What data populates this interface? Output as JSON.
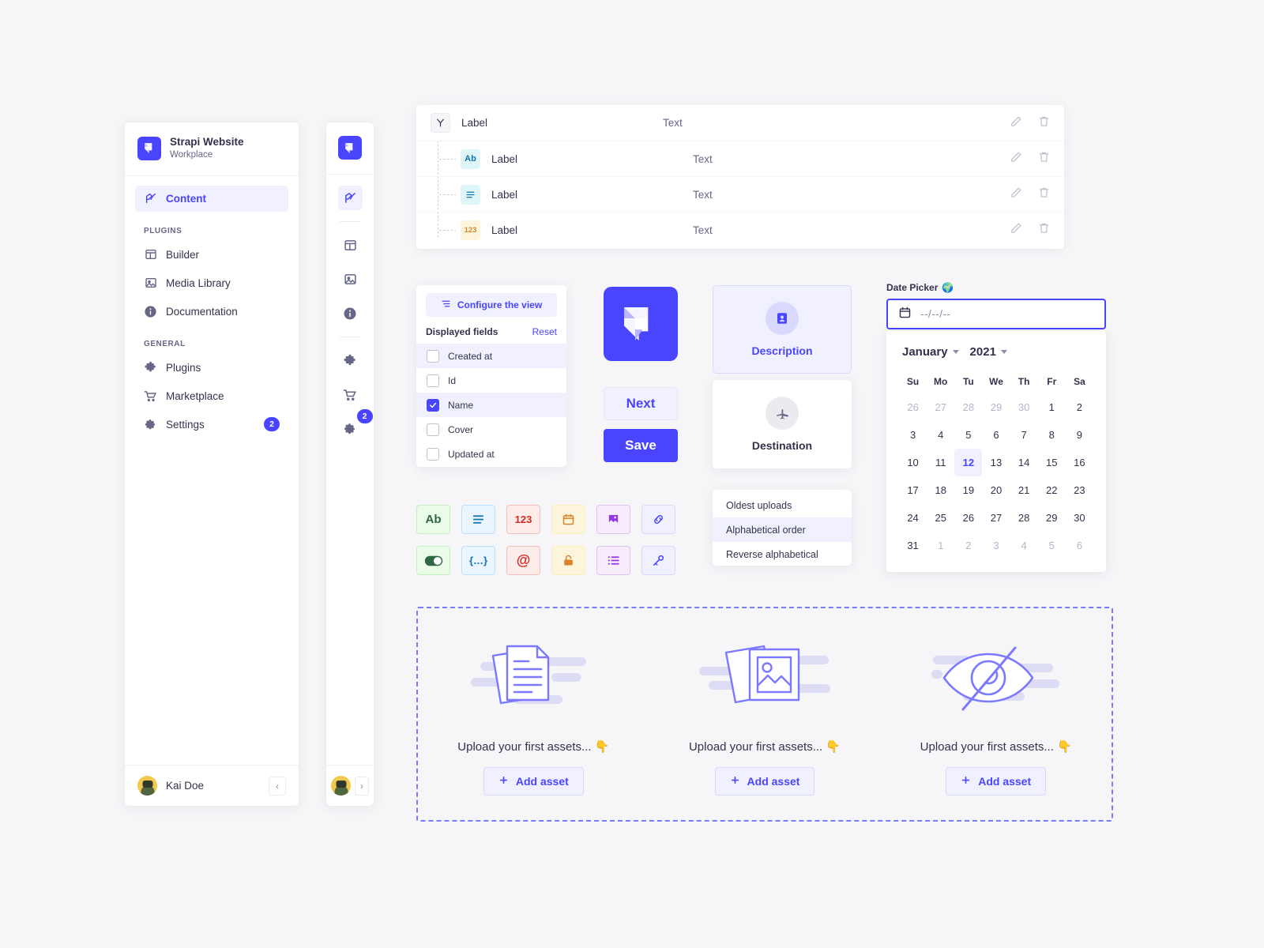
{
  "sidebar": {
    "workspace_name": "Strapi Website",
    "workspace_sub": "Workplace",
    "active_item": "Content",
    "groups": [
      {
        "title": "PLUGINS",
        "items": [
          {
            "label": "Builder",
            "icon": "layout-icon",
            "badge": ""
          },
          {
            "label": "Media Library",
            "icon": "image-icon",
            "badge": ""
          },
          {
            "label": "Documentation",
            "icon": "info-icon",
            "badge": ""
          }
        ]
      },
      {
        "title": "GENERAL",
        "items": [
          {
            "label": "Plugins",
            "icon": "puzzle-icon",
            "badge": ""
          },
          {
            "label": "Marketplace",
            "icon": "cart-icon",
            "badge": ""
          },
          {
            "label": "Settings",
            "icon": "gear-icon",
            "badge": "2"
          }
        ]
      }
    ],
    "user_name": "Kai Doe",
    "collapse_label": "‹"
  },
  "rail": {
    "expand_label": "›",
    "settings_badge": "2"
  },
  "fields_table": {
    "rows": [
      {
        "icon": "branch-icon",
        "icon_text": "",
        "label": "Label",
        "type": "Text",
        "indent": false
      },
      {
        "icon": "text-field-icon",
        "icon_text": "Ab",
        "label": "Label",
        "type": "Text",
        "indent": true
      },
      {
        "icon": "richtext-icon",
        "icon_text": "≡",
        "label": "Label",
        "type": "Text",
        "indent": true
      },
      {
        "icon": "number-icon",
        "icon_text": "123",
        "label": "Label",
        "type": "Text",
        "indent": true
      }
    ],
    "edit_icon": "pencil-icon",
    "delete_icon": "trash-icon"
  },
  "configure_view": {
    "button_label": "Configure the view",
    "section_title": "Displayed fields",
    "reset_label": "Reset",
    "fields": [
      {
        "label": "Created at",
        "checked": false,
        "highlight": true
      },
      {
        "label": "Id",
        "checked": false,
        "highlight": false
      },
      {
        "label": "Name",
        "checked": true,
        "highlight": true
      },
      {
        "label": "Cover",
        "checked": false,
        "highlight": false
      },
      {
        "label": "Updated at",
        "checked": false,
        "highlight": false
      }
    ]
  },
  "actions": {
    "next_label": "Next",
    "save_label": "Save"
  },
  "cards": {
    "description": {
      "label": "Description",
      "icon": "contact-card-icon"
    },
    "destination": {
      "label": "Destination",
      "icon": "airplane-icon"
    }
  },
  "sort_list": {
    "options": [
      {
        "label": "Oldest uploads",
        "selected": false
      },
      {
        "label": "Alphabetical order",
        "selected": true
      },
      {
        "label": "Reverse alphabetical",
        "selected": false
      }
    ]
  },
  "icon_grid": {
    "tiles": [
      {
        "name": "text-icon",
        "glyph": "Ab",
        "color": "green"
      },
      {
        "name": "richtext-icon",
        "glyph": "",
        "color": "blue"
      },
      {
        "name": "number-icon",
        "glyph": "123",
        "color": "red"
      },
      {
        "name": "date-icon",
        "glyph": "",
        "color": "orange"
      },
      {
        "name": "media-icon",
        "glyph": "",
        "color": "purple"
      },
      {
        "name": "relation-icon",
        "glyph": "",
        "color": "indigo"
      },
      {
        "name": "boolean-icon",
        "glyph": "",
        "color": "green"
      },
      {
        "name": "json-icon",
        "glyph": "{…}",
        "color": "blue"
      },
      {
        "name": "email-icon",
        "glyph": "@",
        "color": "red"
      },
      {
        "name": "password-icon",
        "glyph": "",
        "color": "orange"
      },
      {
        "name": "enum-icon",
        "glyph": "",
        "color": "purple"
      },
      {
        "name": "uid-icon",
        "glyph": "",
        "color": "indigo"
      }
    ]
  },
  "date_picker": {
    "label": "Date Picker",
    "label_emoji": "🌍",
    "placeholder": "--/--/--",
    "month": "January",
    "year": "2021",
    "weekdays": [
      "Su",
      "Mo",
      "Tu",
      "We",
      "Th",
      "Fr",
      "Sa"
    ],
    "weeks": [
      [
        {
          "d": "26",
          "out": true
        },
        {
          "d": "27",
          "out": true
        },
        {
          "d": "28",
          "out": true
        },
        {
          "d": "29",
          "out": true
        },
        {
          "d": "30",
          "out": true
        },
        {
          "d": "1",
          "out": false
        },
        {
          "d": "2",
          "out": false
        }
      ],
      [
        {
          "d": "3",
          "out": false
        },
        {
          "d": "4",
          "out": false
        },
        {
          "d": "5",
          "out": false
        },
        {
          "d": "6",
          "out": false
        },
        {
          "d": "7",
          "out": false
        },
        {
          "d": "8",
          "out": false
        },
        {
          "d": "9",
          "out": false
        }
      ],
      [
        {
          "d": "10",
          "out": false
        },
        {
          "d": "11",
          "out": false
        },
        {
          "d": "12",
          "out": false,
          "sel": true
        },
        {
          "d": "13",
          "out": false
        },
        {
          "d": "14",
          "out": false
        },
        {
          "d": "15",
          "out": false
        },
        {
          "d": "16",
          "out": false
        }
      ],
      [
        {
          "d": "17",
          "out": false
        },
        {
          "d": "18",
          "out": false
        },
        {
          "d": "19",
          "out": false
        },
        {
          "d": "20",
          "out": false
        },
        {
          "d": "21",
          "out": false
        },
        {
          "d": "22",
          "out": false
        },
        {
          "d": "23",
          "out": false
        }
      ],
      [
        {
          "d": "24",
          "out": false
        },
        {
          "d": "25",
          "out": false
        },
        {
          "d": "26",
          "out": false
        },
        {
          "d": "27",
          "out": false
        },
        {
          "d": "28",
          "out": false
        },
        {
          "d": "29",
          "out": false
        },
        {
          "d": "30",
          "out": false
        }
      ],
      [
        {
          "d": "31",
          "out": false
        },
        {
          "d": "1",
          "out": true
        },
        {
          "d": "2",
          "out": true
        },
        {
          "d": "3",
          "out": true
        },
        {
          "d": "4",
          "out": true
        },
        {
          "d": "5",
          "out": true
        },
        {
          "d": "6",
          "out": true
        }
      ]
    ],
    "selected_day": "12"
  },
  "empty_states": [
    {
      "illustration": "documents-illustration",
      "text": "Upload your first assets... 👇",
      "button_label": "Add asset"
    },
    {
      "illustration": "images-illustration",
      "text": "Upload your first assets... 👇",
      "button_label": "Add asset"
    },
    {
      "illustration": "eye-off-illustration",
      "text": "Upload your first assets... 👇",
      "button_label": "Add asset"
    }
  ],
  "colors": {
    "brand": "#4945ff",
    "brand_light": "#f0f0ff",
    "page_bg": "#f6f6f9",
    "text": "#32324d",
    "muted": "#666687",
    "dashed_border": "#7b79ff"
  }
}
